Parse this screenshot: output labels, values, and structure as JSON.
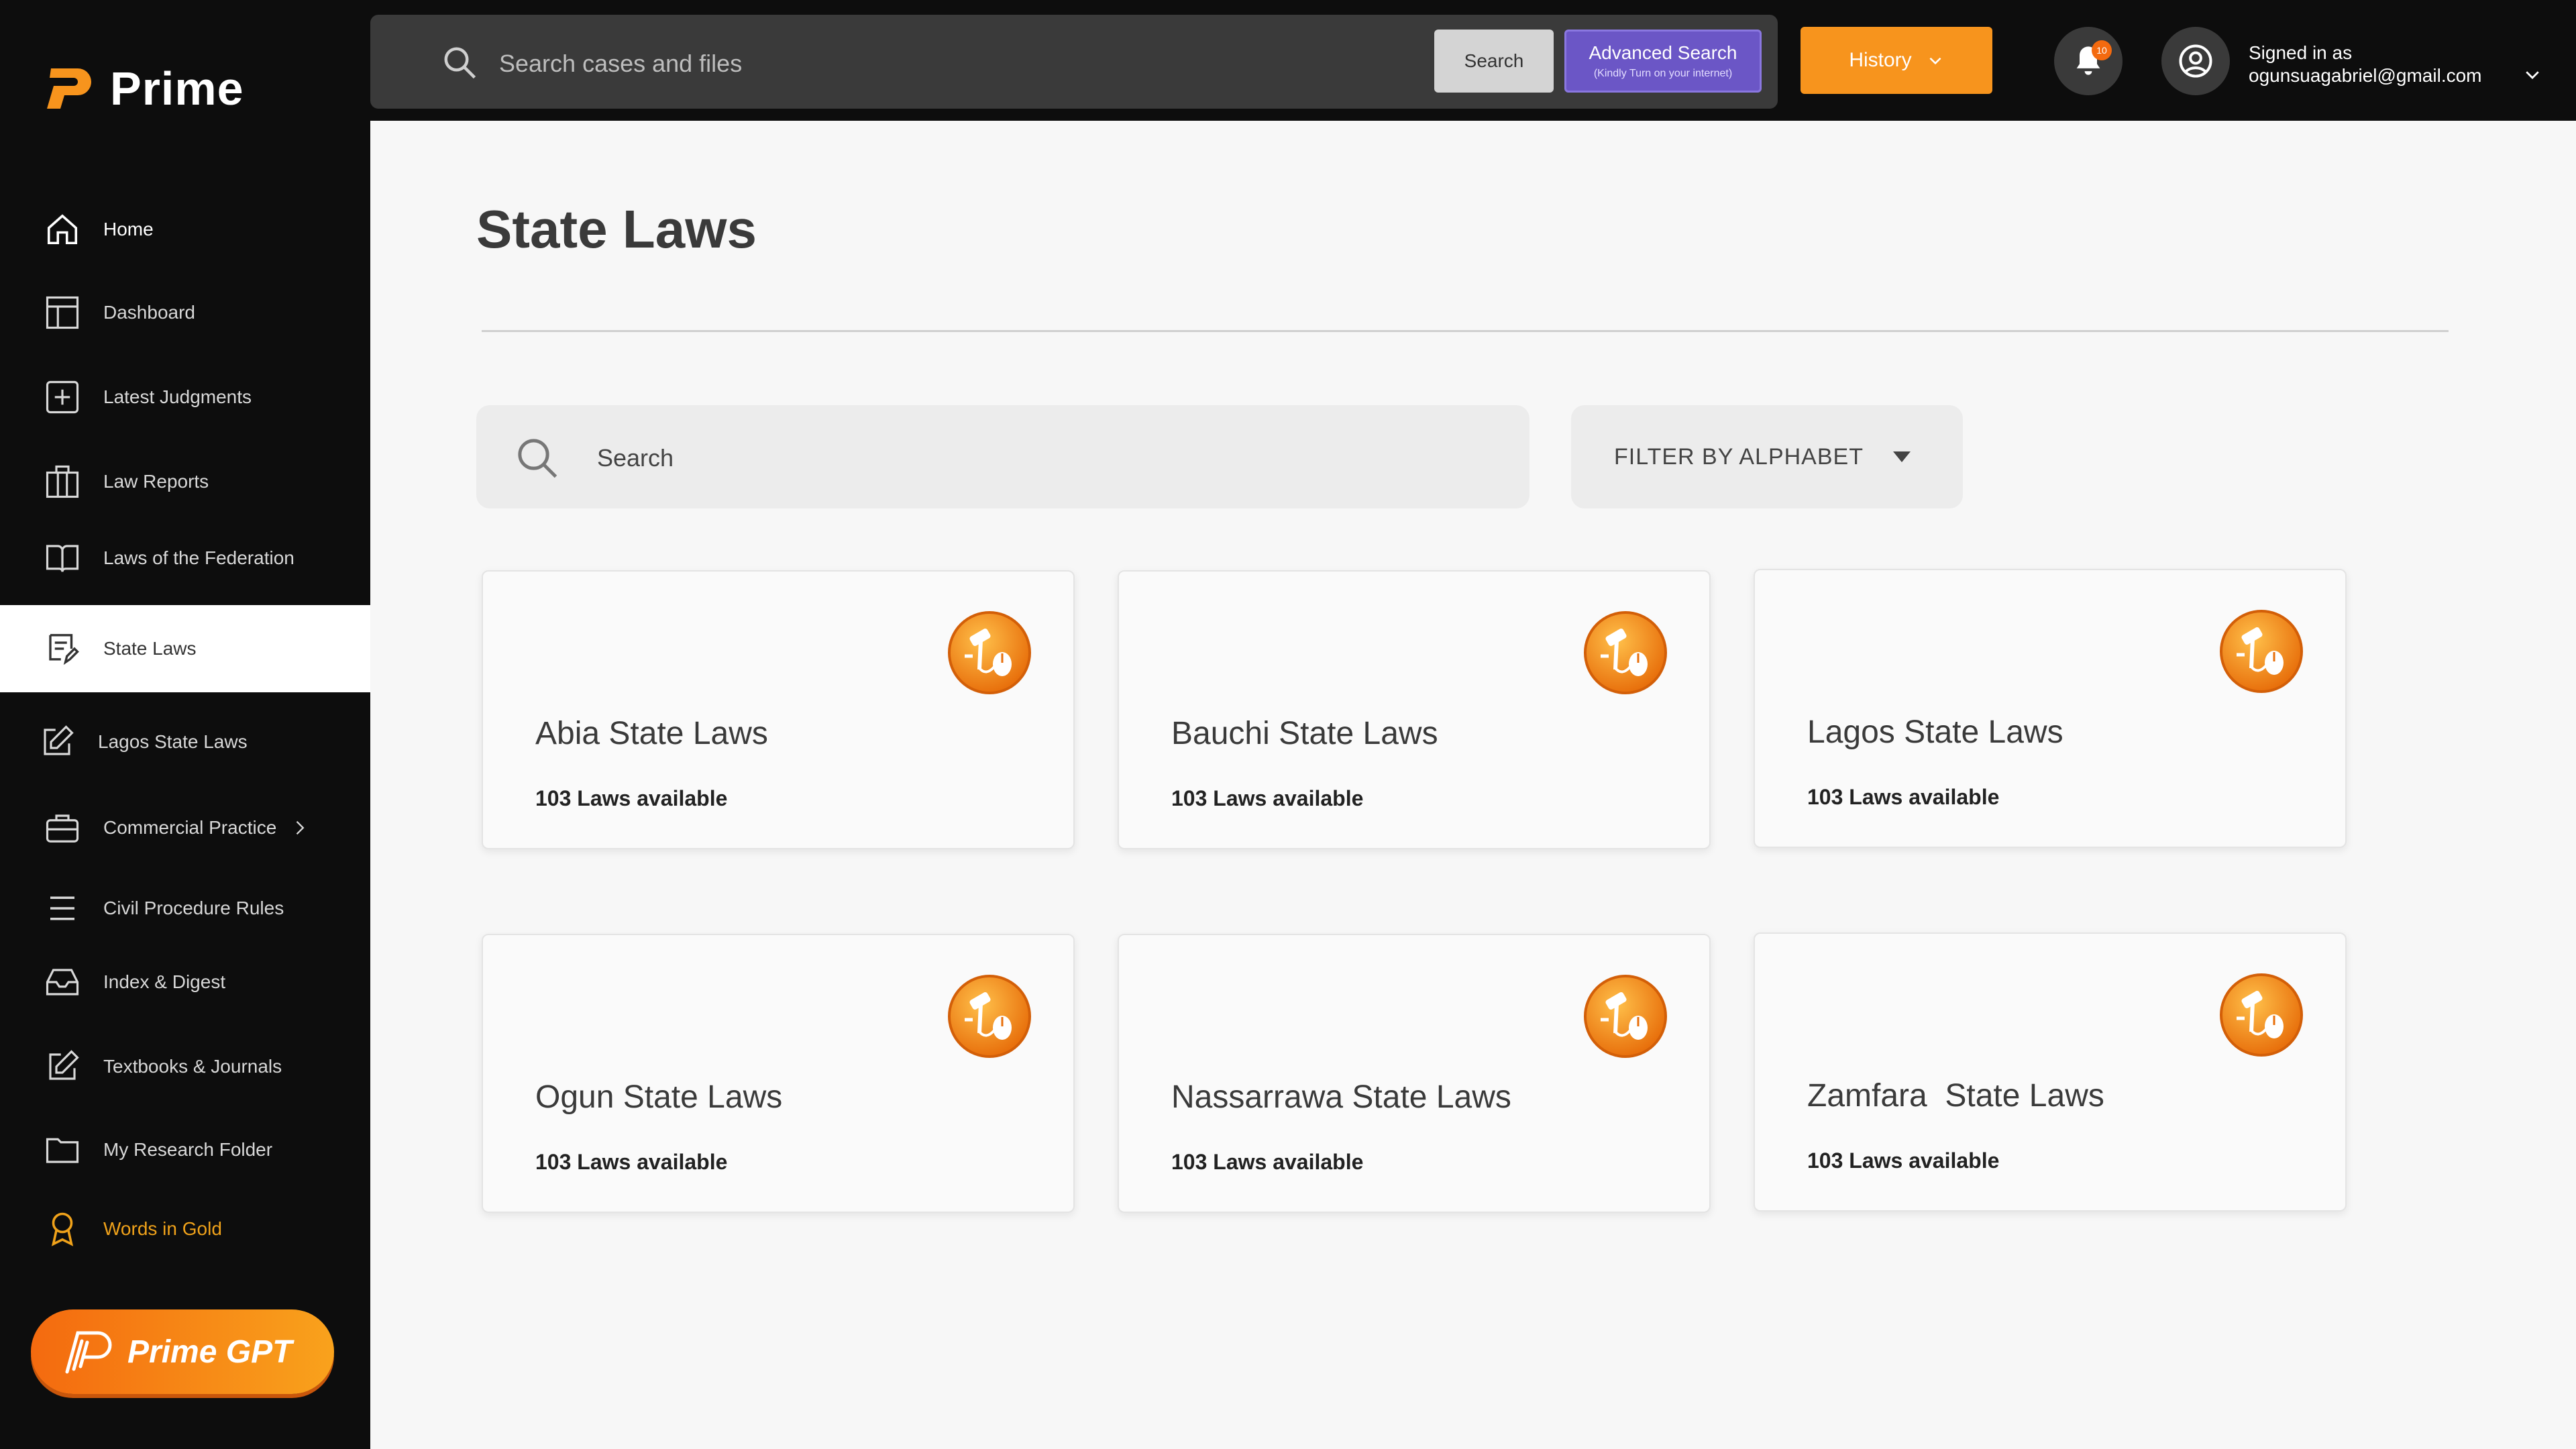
{
  "brand": {
    "name": "Prime",
    "accent": "#f7941d"
  },
  "sidebar": {
    "items": [
      {
        "label": "Home",
        "icon": "home-icon"
      },
      {
        "label": "Dashboard",
        "icon": "layout-icon"
      },
      {
        "label": "Latest Judgments",
        "icon": "plus-square-icon"
      },
      {
        "label": "Law Reports",
        "icon": "columns-icon"
      },
      {
        "label": "Laws of the Federation",
        "icon": "book-open-icon"
      },
      {
        "label": "State Laws",
        "icon": "document-edit-icon",
        "active": true
      },
      {
        "label": "Lagos State Laws",
        "icon": "edit-icon"
      },
      {
        "label": "Commercial Practice",
        "icon": "briefcase-icon",
        "has_submenu": true
      },
      {
        "label": "Civil Procedure Rules",
        "icon": "menu-lines-icon"
      },
      {
        "label": "Index & Digest",
        "icon": "inbox-icon"
      },
      {
        "label": "Textbooks & Journals",
        "icon": "edit-icon"
      },
      {
        "label": "My Research Folder",
        "icon": "folder-icon"
      },
      {
        "label": "Words in Gold",
        "icon": "award-icon"
      }
    ],
    "prime_gpt_label": "Prime GPT"
  },
  "topbar": {
    "search_placeholder": "Search cases and files",
    "search_button": "Search",
    "advanced_search": "Advanced Search",
    "advanced_search_note": "(Kindly Turn on your internet)",
    "history_button": "History",
    "notification_count": "10",
    "signed_in_label": "Signed in as",
    "user_email": "ogunsuagabriel@gmail.com"
  },
  "main": {
    "title": "State Laws",
    "search_placeholder": "Search",
    "filter_label": "FILTER BY ALPHABET",
    "cards": [
      {
        "title": "Abia State Laws",
        "count": "103 Laws available"
      },
      {
        "title": "Bauchi State Laws",
        "count": "103 Laws available"
      },
      {
        "title": "Lagos State Laws",
        "count": "103 Laws available"
      },
      {
        "title": "Ogun State Laws",
        "count": "103 Laws available"
      },
      {
        "title": "Nassarrawa State Laws",
        "count": "103 Laws available"
      },
      {
        "title": "Zamfara  State Laws",
        "count": "103 Laws available"
      }
    ]
  }
}
